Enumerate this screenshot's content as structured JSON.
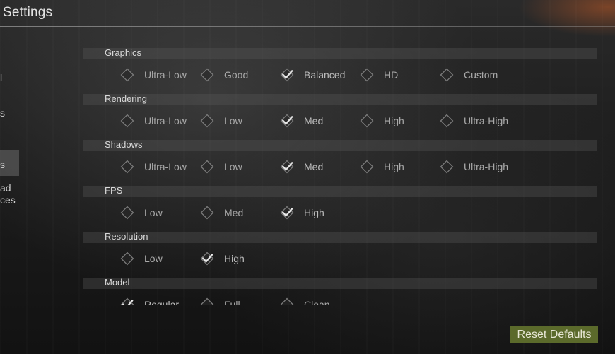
{
  "header": {
    "title": "Settings"
  },
  "sidebar": {
    "items": [
      {
        "label": "l"
      },
      {
        "label": "s"
      },
      {
        "label": ""
      },
      {
        "label": "s"
      },
      {
        "label": "ad\nces"
      }
    ],
    "selected_index": 2
  },
  "sections": [
    {
      "title": "Graphics",
      "options": [
        {
          "label": "Ultra-Low",
          "checked": false
        },
        {
          "label": "Good",
          "checked": false
        },
        {
          "label": "Balanced",
          "checked": true
        },
        {
          "label": "HD",
          "checked": false
        },
        {
          "label": "Custom",
          "checked": false
        }
      ]
    },
    {
      "title": "Rendering",
      "options": [
        {
          "label": "Ultra-Low",
          "checked": false
        },
        {
          "label": "Low",
          "checked": false
        },
        {
          "label": "Med",
          "checked": true
        },
        {
          "label": "High",
          "checked": false
        },
        {
          "label": "Ultra-High",
          "checked": false
        }
      ]
    },
    {
      "title": "Shadows",
      "options": [
        {
          "label": "Ultra-Low",
          "checked": false
        },
        {
          "label": "Low",
          "checked": false
        },
        {
          "label": "Med",
          "checked": true
        },
        {
          "label": "High",
          "checked": false
        },
        {
          "label": "Ultra-High",
          "checked": false
        }
      ]
    },
    {
      "title": "FPS",
      "options": [
        {
          "label": "Low",
          "checked": false
        },
        {
          "label": "Med",
          "checked": false
        },
        {
          "label": "High",
          "checked": true
        }
      ]
    },
    {
      "title": "Resolution",
      "options": [
        {
          "label": "Low",
          "checked": false
        },
        {
          "label": "High",
          "checked": true
        }
      ]
    },
    {
      "title": "Model",
      "options": [
        {
          "label": "Regular",
          "checked": true
        },
        {
          "label": "Full",
          "checked": false
        },
        {
          "label": "Clean",
          "checked": false
        }
      ]
    }
  ],
  "footer": {
    "reset_label": "Reset Defaults"
  },
  "colors": {
    "button_bg": "#5b6a2b",
    "section_header_bg": "#3a3a3a",
    "accent_glow": "#be5a28"
  }
}
